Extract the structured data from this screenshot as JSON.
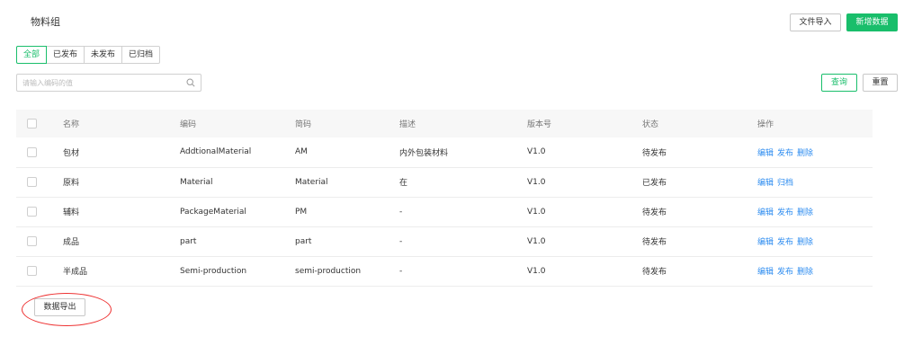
{
  "page": {
    "title": "物料组"
  },
  "toolbar": {
    "import_label": "文件导入",
    "add_label": "新增数据"
  },
  "tabs": [
    {
      "label": "全部",
      "active": true
    },
    {
      "label": "已发布",
      "active": false
    },
    {
      "label": "未发布",
      "active": false
    },
    {
      "label": "已归档",
      "active": false
    }
  ],
  "search": {
    "placeholder": "请输入编码的值",
    "value": "",
    "query_label": "查询",
    "reset_label": "重置"
  },
  "table": {
    "headers": [
      "名称",
      "编码",
      "简码",
      "描述",
      "版本号",
      "状态",
      "操作"
    ],
    "rows": [
      {
        "name": "包材",
        "code": "AddtionalMaterial",
        "short": "AM",
        "desc": "内外包装材料",
        "version": "V1.0",
        "status": "待发布",
        "actions": [
          "编辑",
          "发布",
          "删除"
        ]
      },
      {
        "name": "原料",
        "code": "Material",
        "short": "Material",
        "desc": "在",
        "version": "V1.0",
        "status": "已发布",
        "actions": [
          "编辑",
          "归档"
        ]
      },
      {
        "name": "辅料",
        "code": "PackageMaterial",
        "short": "PM",
        "desc": "-",
        "version": "V1.0",
        "status": "待发布",
        "actions": [
          "编辑",
          "发布",
          "删除"
        ]
      },
      {
        "name": "成品",
        "code": "part",
        "short": "part",
        "desc": "-",
        "version": "V1.0",
        "status": "待发布",
        "actions": [
          "编辑",
          "发布",
          "删除"
        ]
      },
      {
        "name": "半成品",
        "code": "Semi-production",
        "short": "semi-production",
        "desc": "-",
        "version": "V1.0",
        "status": "待发布",
        "actions": [
          "编辑",
          "发布",
          "删除"
        ]
      }
    ]
  },
  "footer": {
    "export_label": "数据导出"
  },
  "colors": {
    "accent": "#19be6b",
    "link": "#2d8cf0",
    "highlight_circle": "#e33333"
  },
  "icons": {
    "search": "search-icon"
  }
}
